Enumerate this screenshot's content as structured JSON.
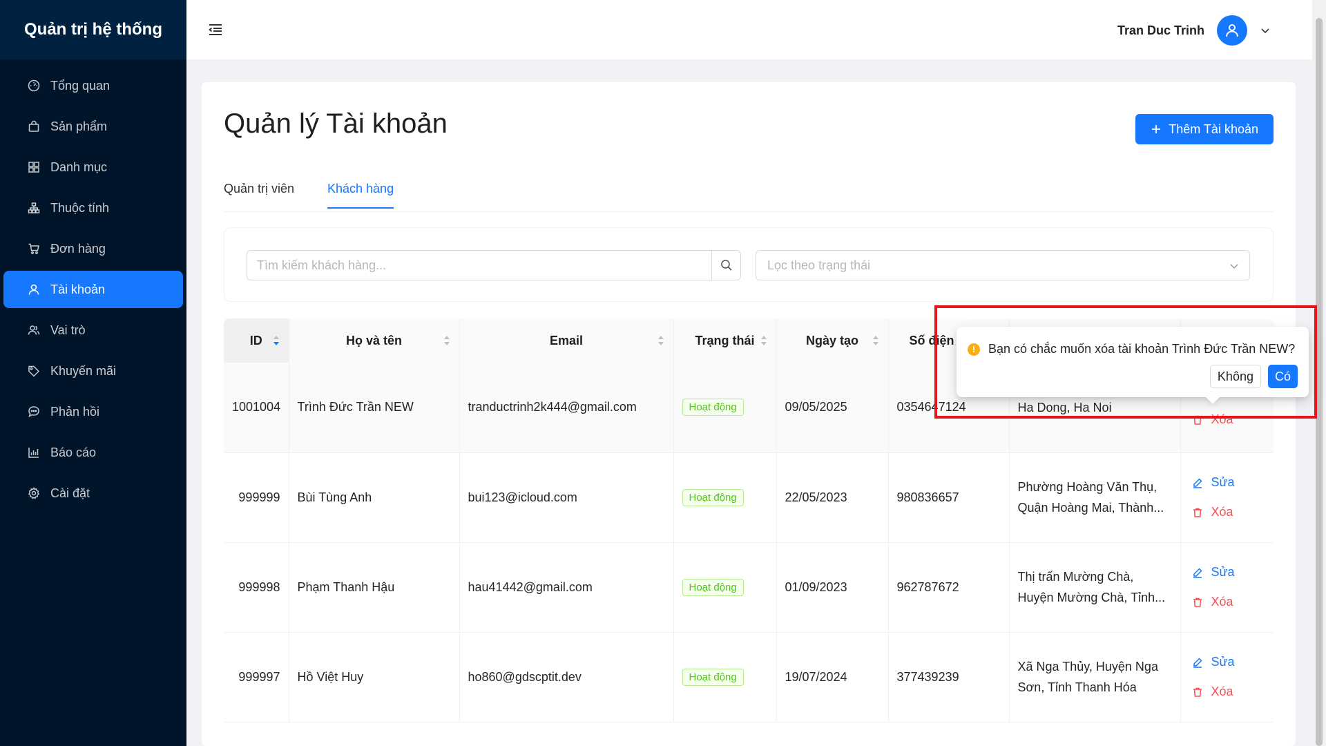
{
  "sidebar": {
    "brand": "Quản trị hệ thống",
    "items": [
      {
        "label": "Tổng quan",
        "icon": "dashboard-icon"
      },
      {
        "label": "Sản phẩm",
        "icon": "shopping-bag-icon"
      },
      {
        "label": "Danh mục",
        "icon": "grid-icon"
      },
      {
        "label": "Thuộc tính",
        "icon": "cluster-icon"
      },
      {
        "label": "Đơn hàng",
        "icon": "cart-icon"
      },
      {
        "label": "Tài khoản",
        "icon": "user-icon",
        "active": true
      },
      {
        "label": "Vai trò",
        "icon": "team-icon"
      },
      {
        "label": "Khuyến mãi",
        "icon": "tag-icon"
      },
      {
        "label": "Phản hồi",
        "icon": "comment-icon"
      },
      {
        "label": "Báo cáo",
        "icon": "bar-chart-icon"
      },
      {
        "label": "Cài đặt",
        "icon": "gear-icon"
      }
    ]
  },
  "header": {
    "user_name": "Tran Duc Trinh"
  },
  "page": {
    "title": "Quản lý Tài khoản",
    "add_button": "Thêm Tài khoản",
    "tabs": [
      "Quản trị viên",
      "Khách hàng"
    ],
    "active_tab": "Khách hàng",
    "search_placeholder": "Tìm kiếm khách hàng...",
    "status_filter_placeholder": "Lọc theo trạng thái"
  },
  "table": {
    "columns": [
      "ID",
      "Họ và tên",
      "Email",
      "Trạng thái",
      "Ngày tạo",
      "Số điện"
    ],
    "rows": [
      {
        "id": "1001004",
        "name": "Trình Đức Trần NEW",
        "email": "tranductrinh2k444@gmail.com",
        "status": "Hoạt động",
        "created": "09/05/2025",
        "phone": "0354647124",
        "address": "Ha Dong, Ha Noi"
      },
      {
        "id": "999999",
        "name": "Bùi Tùng Anh",
        "email": "bui123@icloud.com",
        "status": "Hoạt động",
        "created": "22/05/2023",
        "phone": "980836657",
        "address": "Phường Hoàng Văn Thụ, Quận Hoàng Mai, Thành..."
      },
      {
        "id": "999998",
        "name": "Phạm Thanh Hậu",
        "email": "hau41442@gmail.com",
        "status": "Hoạt động",
        "created": "01/09/2023",
        "phone": "962787672",
        "address": "Thị trấn Mường Chà, Huyện Mường Chà, Tỉnh..."
      },
      {
        "id": "999997",
        "name": "Hồ Việt Huy",
        "email": "ho860@gdscptit.dev",
        "status": "Hoạt động",
        "created": "19/07/2024",
        "phone": "377439239",
        "address": "Xã Nga Thủy, Huyện Nga Sơn, Tỉnh Thanh Hóa"
      }
    ],
    "edit_label": "Sửa",
    "delete_label": "Xóa"
  },
  "popconfirm": {
    "message": "Bạn có chắc muốn xóa tài khoản Trình Đức Trần NEW?",
    "cancel": "Không",
    "ok": "Có"
  },
  "colors": {
    "primary": "#1677ff",
    "sidebar_bg": "#001529",
    "danger": "#ff4d4f",
    "success": "#52c41a",
    "highlight_box": "#e8141b"
  }
}
